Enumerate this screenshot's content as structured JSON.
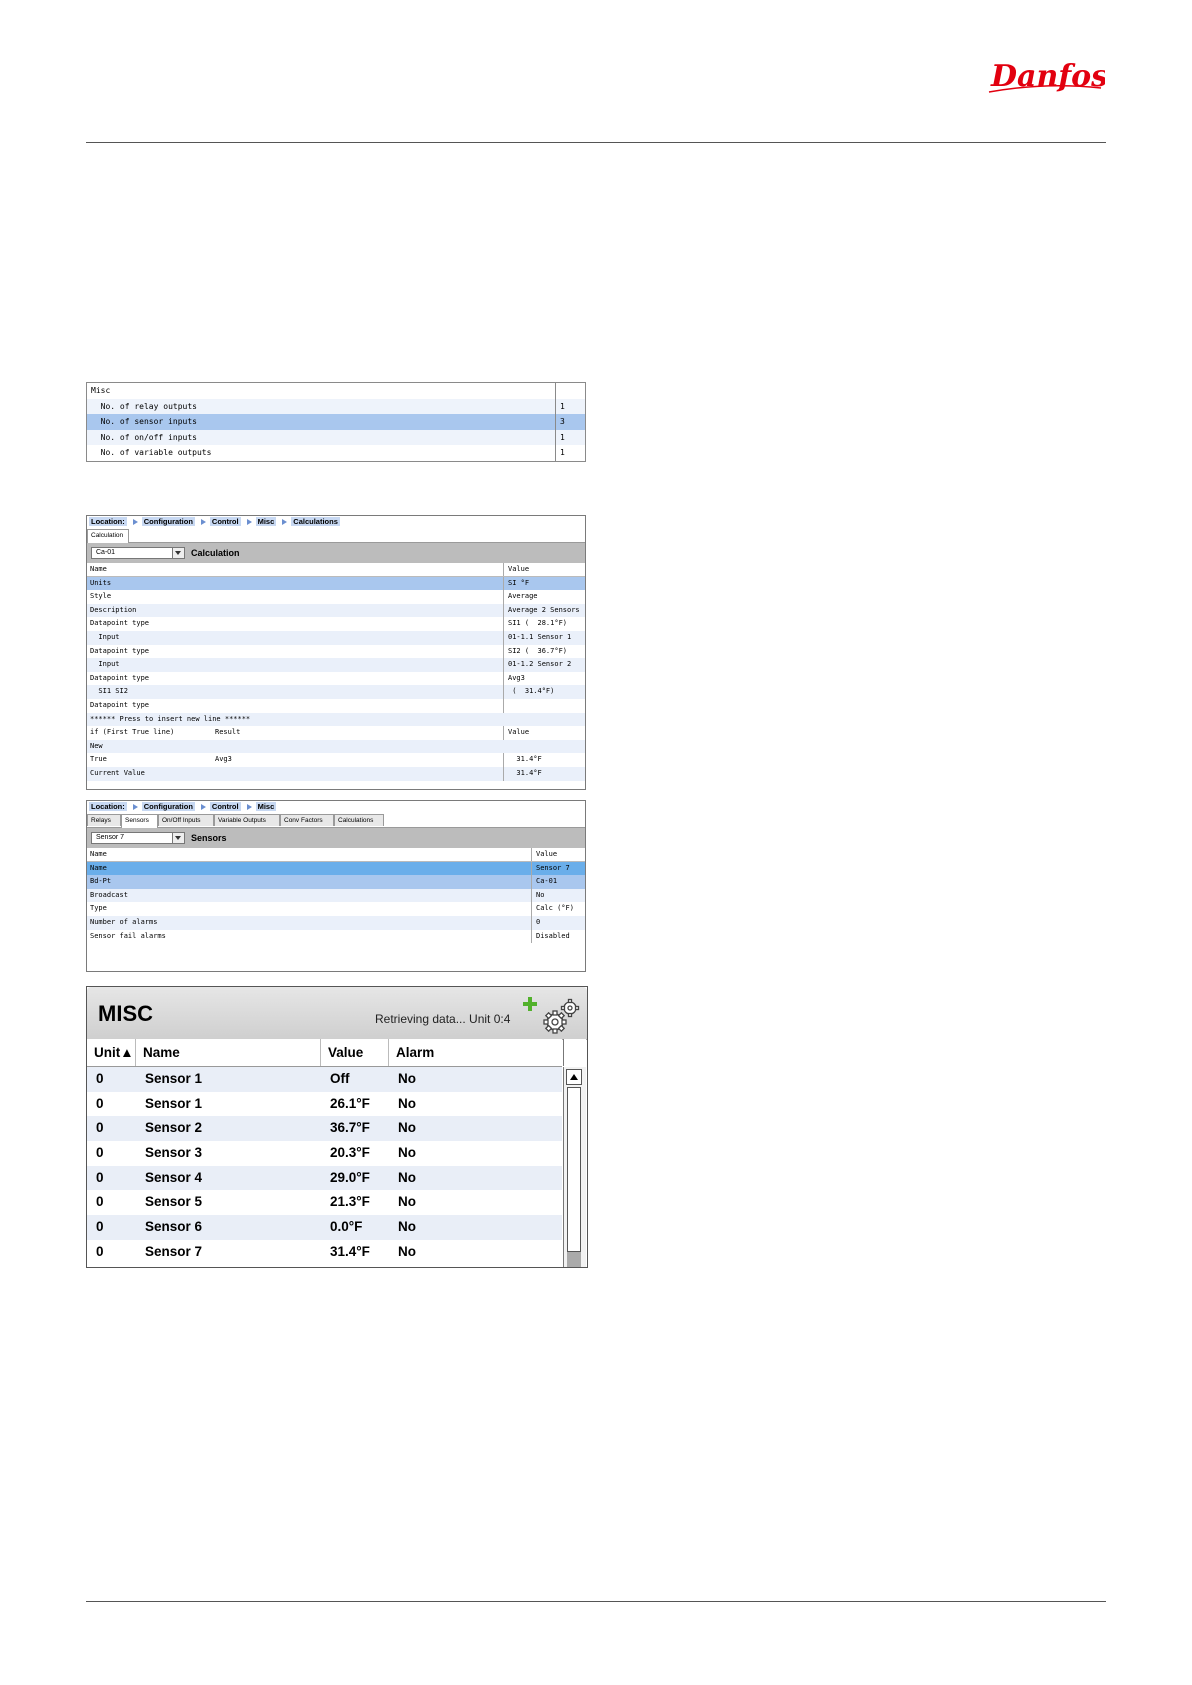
{
  "brand": {
    "name": "Danfoss",
    "color": "#e2000f"
  },
  "misc_table": {
    "rows": [
      {
        "label": "Misc",
        "value": ""
      },
      {
        "label": "  No. of relay outputs",
        "value": "1"
      },
      {
        "label": "  No. of sensor inputs",
        "value": "3"
      },
      {
        "label": "  No. of on/off inputs",
        "value": "1"
      },
      {
        "label": "  No. of variable outputs",
        "value": "1"
      }
    ]
  },
  "calc_panel": {
    "location_label": "Location:",
    "crumbs": [
      "Configuration",
      "Control",
      "Misc",
      "Calculations"
    ],
    "tab": "Calculation",
    "select_value": "Ca-01",
    "title": "Calculation",
    "col_name": "Name",
    "col_value": "Value",
    "rows": [
      {
        "name": "Units",
        "mid": "",
        "value": "SI °F"
      },
      {
        "name": "Style",
        "mid": "",
        "value": "Average"
      },
      {
        "name": "Description",
        "mid": "",
        "value": "Average 2 Sensors"
      },
      {
        "name": "Datapoint type",
        "mid": "",
        "value": "SI1 (  28.1°F)"
      },
      {
        "name": "  Input",
        "mid": "",
        "value": "01-1.1 Sensor 1"
      },
      {
        "name": "Datapoint type",
        "mid": "",
        "value": "SI2 (  36.7°F)"
      },
      {
        "name": "  Input",
        "mid": "",
        "value": "01-1.2 Sensor 2"
      },
      {
        "name": "Datapoint type",
        "mid": "",
        "value": "Avg3"
      },
      {
        "name": "  SI1 SI2",
        "mid": "",
        "value": " (  31.4°F)"
      },
      {
        "name": "Datapoint type",
        "mid": "",
        "value": ""
      },
      {
        "name": "****** Press to insert new line ******",
        "mid": "",
        "value": ""
      },
      {
        "name": "if (First True line)",
        "mid": "Result",
        "value": "Value"
      },
      {
        "name": "New",
        "mid": "",
        "value": ""
      },
      {
        "name": "True",
        "mid": "Avg3",
        "value": "  31.4°F"
      },
      {
        "name": "Current Value",
        "mid": "",
        "value": "  31.4°F"
      }
    ]
  },
  "sensors_panel": {
    "location_label": "Location:",
    "crumbs": [
      "Configuration",
      "Control",
      "Misc"
    ],
    "tabs": [
      "Relays",
      "Sensors",
      "On/Off Inputs",
      "Variable Outputs",
      "Conv Factors",
      "Calculations"
    ],
    "active_tab": "Sensors",
    "select_value": "Sensor 7",
    "title": "Sensors",
    "col_name": "Name",
    "col_value": "Value",
    "rows": [
      {
        "name": "Name",
        "value": "Sensor 7"
      },
      {
        "name": "Bd-Pt",
        "value": "Ca-01"
      },
      {
        "name": "Broadcast",
        "value": "No"
      },
      {
        "name": "Type",
        "value": "Calc (°F)"
      },
      {
        "name": "Number of alarms",
        "value": "0"
      },
      {
        "name": "Sensor fail alarms",
        "value": "Disabled"
      }
    ]
  },
  "misc_widget": {
    "title": "MISC",
    "status": "Retrieving data... Unit 0:4",
    "columns": [
      "Unit▲",
      "Name",
      "Value",
      "Alarm"
    ],
    "rows": [
      {
        "unit": "0",
        "name": "Sensor 1",
        "value": "Off",
        "alarm": "No"
      },
      {
        "unit": "0",
        "name": "Sensor 1",
        "value": "26.1°F",
        "alarm": "No"
      },
      {
        "unit": "0",
        "name": "Sensor 2",
        "value": "36.7°F",
        "alarm": "No"
      },
      {
        "unit": "0",
        "name": "Sensor 3",
        "value": "20.3°F",
        "alarm": "No"
      },
      {
        "unit": "0",
        "name": "Sensor 4",
        "value": "29.0°F",
        "alarm": "No"
      },
      {
        "unit": "0",
        "name": "Sensor 5",
        "value": "21.3°F",
        "alarm": "No"
      },
      {
        "unit": "0",
        "name": "Sensor 6",
        "value": "0.0°F",
        "alarm": "No"
      },
      {
        "unit": "0",
        "name": "Sensor 7",
        "value": "31.4°F",
        "alarm": "No"
      }
    ],
    "icons": [
      "plus-icon",
      "gear-icon"
    ]
  }
}
